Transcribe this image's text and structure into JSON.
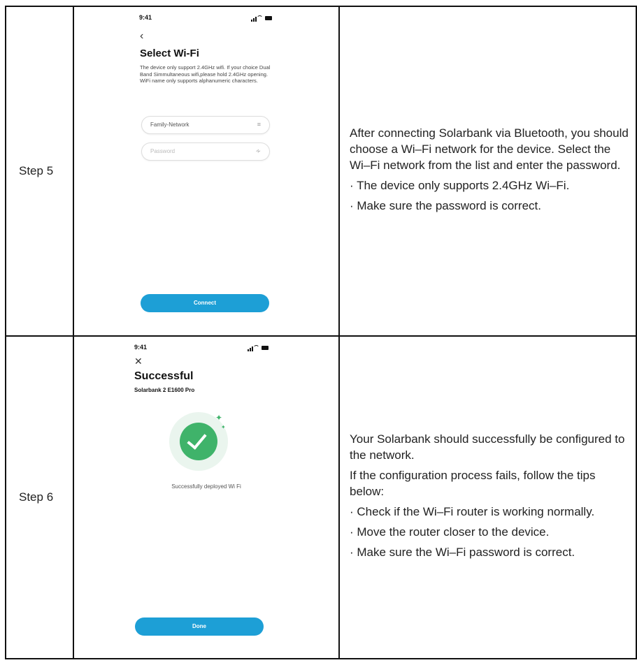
{
  "step5": {
    "label": "Step 5",
    "phone": {
      "time": "9:41",
      "back_icon": "chevron-left-icon",
      "title": "Select Wi-Fi",
      "instructions": "The device only support 2.4GHz wifi. If your choice Dual Band Simmultaneous wifi,please hold 2.4GHz opening. WiFi name only supports alphanumeric characters.",
      "wifi_value": "Family-Network",
      "password_placeholder": "Password",
      "button": "Connect"
    },
    "description": [
      "After connecting Solarbank via Bluetooth, you should choose a Wi–Fi network for the device. Select the Wi–Fi network from the list and enter the password.",
      "· The device only supports 2.4GHz Wi–Fi.",
      "· Make sure the password is correct."
    ]
  },
  "step6": {
    "label": "Step 6",
    "phone": {
      "time": "9:41",
      "close_icon": "close-icon",
      "title": "Successful",
      "device_name": "Solarbank 2 E1600 Pro",
      "status": "Successfully deployed Wi Fi",
      "button": "Done"
    },
    "description": [
      "Your Solarbank should successfully be configured to the network.",
      "If the configuration process fails, follow the tips below:",
      "· Check if the Wi–Fi router is working normally.",
      "· Move the router closer to the device.",
      "· Make sure the Wi–Fi password is correct."
    ]
  },
  "colors": {
    "button": "#1d9fd6",
    "success": "#3fb36a",
    "border": "#111111"
  }
}
